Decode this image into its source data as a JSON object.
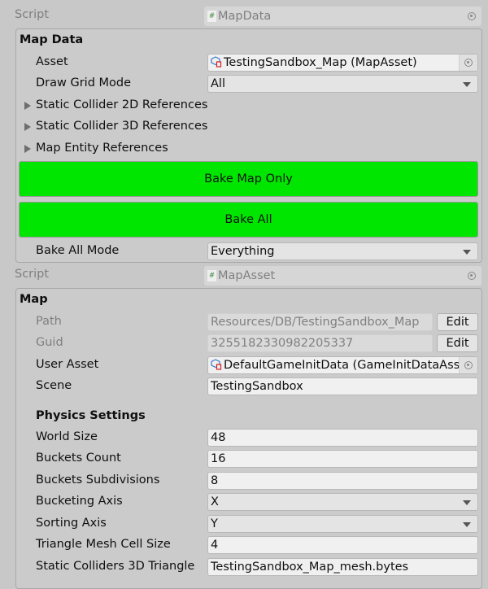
{
  "map_data_component": {
    "script_label": "Script",
    "script_value": "MapData",
    "section_title": "Map Data",
    "asset": {
      "label": "Asset",
      "value": "TestingSandbox_Map (MapAsset)"
    },
    "draw_grid_mode": {
      "label": "Draw Grid Mode",
      "value": "All"
    },
    "foldouts": [
      "Static Collider 2D References",
      "Static Collider 3D References",
      "Map Entity References"
    ],
    "bake_map_only_label": "Bake Map Only",
    "bake_all_label": "Bake All",
    "bake_all_mode": {
      "label": "Bake All Mode",
      "value": "Everything"
    },
    "button_color": "#00e600"
  },
  "map_asset_component": {
    "script_label": "Script",
    "script_value": "MapAsset",
    "section_title": "Map",
    "path": {
      "label": "Path",
      "value": "Resources/DB/TestingSandbox_Map",
      "button": "Edit"
    },
    "guid": {
      "label": "Guid",
      "value": "3255182330982205337",
      "button": "Edit"
    },
    "user_asset": {
      "label": "User Asset",
      "value": "DefaultGameInitData (GameInitDataAsset)"
    },
    "scene": {
      "label": "Scene",
      "value": "TestingSandbox"
    },
    "physics_title": "Physics Settings",
    "world_size": {
      "label": "World Size",
      "value": "48"
    },
    "buckets_count": {
      "label": "Buckets Count",
      "value": "16"
    },
    "buckets_subdivisions": {
      "label": "Buckets Subdivisions",
      "value": "8"
    },
    "bucketing_axis": {
      "label": "Bucketing Axis",
      "value": "X"
    },
    "sorting_axis": {
      "label": "Sorting Axis",
      "value": "Y"
    },
    "triangle_mesh_cell_size": {
      "label": "Triangle Mesh Cell Size",
      "value": "4"
    },
    "static_colliders_3d_triangle": {
      "label": "Static Colliders 3D Triangle",
      "value": "TestingSandbox_Map_mesh.bytes"
    }
  }
}
